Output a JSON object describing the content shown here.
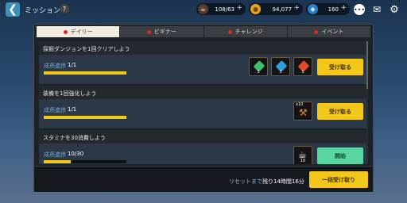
{
  "header": {
    "back_glyph": "❮",
    "title": "ミッション",
    "help_glyph": "?",
    "resources": [
      {
        "icon": "coffee-cup-icon",
        "value": "108/63"
      },
      {
        "icon": "gold-coin-icon",
        "value": "94,077"
      },
      {
        "icon": "blue-diamond-icon",
        "value": "160"
      }
    ],
    "plus_glyph": "+"
  },
  "tabs": [
    {
      "label": "デイリー",
      "active": true
    },
    {
      "label": "ビギナー",
      "active": false
    },
    {
      "label": "チャレンジ",
      "active": false
    },
    {
      "label": "イベント",
      "active": false
    }
  ],
  "missions": [
    {
      "title": "採掘ダンジョンを1回クリアしよう",
      "progress_label": "成長進捗",
      "progress_value": "1/1",
      "progress_fraction": 1.0,
      "rewards": [
        {
          "icon": "red-gem-icon",
          "qty": "1",
          "color": "#3fbf6a"
        },
        {
          "icon": "blue-gem-icon",
          "qty": "3",
          "color": "#2f9ee0"
        },
        {
          "icon": "orange-gem-icon",
          "qty": "1",
          "color": "#e04a2a"
        }
      ],
      "button_label": "受け取る",
      "button_type": "claim"
    },
    {
      "title": "装備を1回強化しよう",
      "progress_label": "成長進捗",
      "progress_value": "1/1",
      "progress_fraction": 1.0,
      "rewards": [
        {
          "icon": "hammer-icon",
          "qty": "",
          "top_label": "x10",
          "color": "#e08a2a"
        }
      ],
      "button_label": "受け取る",
      "button_type": "claim"
    },
    {
      "title": "スタミナを30消費しよう",
      "progress_label": "成長進捗",
      "progress_value": "10/30",
      "progress_fraction": 0.33,
      "rewards": [
        {
          "icon": "coffee-cup-icon",
          "qty": "10",
          "color": "#8a5a3a"
        }
      ],
      "button_label": "開始",
      "button_type": "start"
    }
  ],
  "footer": {
    "reset_label": "リセットまで",
    "reset_time": "残り14時間16分",
    "claim_all_label": "一括受け取り"
  }
}
